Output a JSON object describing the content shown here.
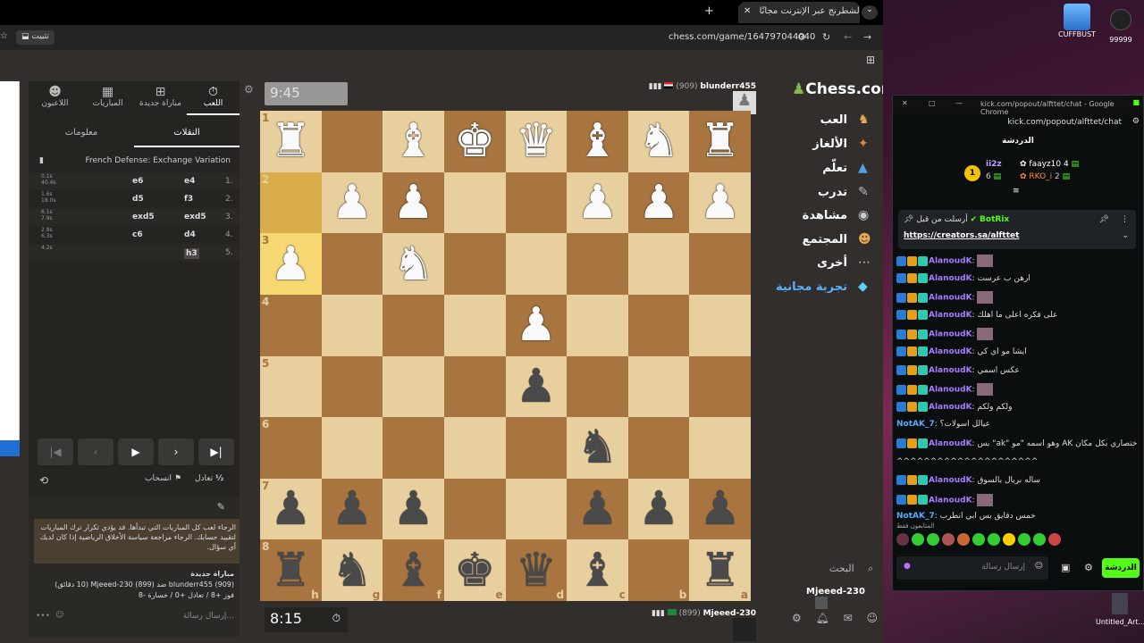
{
  "browser": {
    "tab_title": "إلعب الشطرنج عبر الإنترنت مجانًا",
    "url": "chess.com/game/164797044040",
    "install_label": "تثبيت"
  },
  "chess_nav": {
    "logo": "Chess.com",
    "items": [
      "العب",
      "الألغاز",
      "تعلّم",
      "تدرب",
      "مشاهدة",
      "المجتمع",
      "أخرى",
      "تجربة مجانية"
    ],
    "search_label": "البحث",
    "username": "Mjeeed-230"
  },
  "game": {
    "top_player": {
      "name": "blunderr455",
      "rating": "(909)",
      "clock": "9:45"
    },
    "bottom_player": {
      "name": "Mjeeed-230",
      "rating": "(899)",
      "clock": "8:15"
    },
    "files": [
      "h",
      "g",
      "f",
      "e",
      "d",
      "c",
      "b",
      "a"
    ],
    "ranks": [
      "1",
      "2",
      "3",
      "4",
      "5",
      "6",
      "7",
      "8"
    ]
  },
  "panel": {
    "tabs": [
      "اللعب",
      "مباراة جديدة",
      "المباريات",
      "اللاعبون"
    ],
    "subtabs": [
      "النقلات",
      "معلومات"
    ],
    "opening": "French Defense: Exchange Variation",
    "moves": [
      {
        "n": "1.",
        "w": "e4",
        "b": "e6",
        "t1": "0.1s",
        "t2": "40.4s"
      },
      {
        "n": "2.",
        "w": "f3",
        "b": "d5",
        "t1": "1.6s",
        "t2": "18.0s"
      },
      {
        "n": "3.",
        "w": "exd5",
        "b": "exd5",
        "t1": "6.1s",
        "t2": "7.9s"
      },
      {
        "n": "4.",
        "w": "d4",
        "b": "c6",
        "t1": "2.8s",
        "t2": "6.3s"
      },
      {
        "n": "5.",
        "w": "h3",
        "b": "",
        "t1": "4.2s",
        "t2": ""
      }
    ],
    "draw_label": "تعادل",
    "resign_label": "انسحاب",
    "warning": "الرجاء لعب كل المباريات التي تبدأها. قد يؤدي تكرار ترك المباريات لتقييد حسابك. الرجاء مراجعة سياسة الأخلاق الرياضية إذا كان لديك أي سؤال.",
    "new_game_title": "مباراة جديدة",
    "new_game_line1": "blunderr455 (909) ضد Mjeeed-230 (899) (10 دقائق)",
    "new_game_line2": "فوز +8 / تعادل +0 / خسارة -8",
    "message_placeholder": "إرسال رسالة..."
  },
  "kick": {
    "window_title": "kick.com/popout/alfttet/chat - Google Chrome",
    "url": "kick.com/popout/alfttet/chat",
    "header": "الدردشة",
    "top_gifters": [
      {
        "name": "ii2z",
        "count": "6"
      },
      {
        "name": "faayz10",
        "count": "4"
      },
      {
        "name": "RKO_i",
        "count": "2"
      }
    ],
    "pinned_by": "أرسلت من قبل",
    "pinned_user": "BotRix",
    "pinned_link": "https://creators.sa/alfttet",
    "messages": [
      {
        "user": "AlanoudK",
        "text": ""
      },
      {
        "user": "AlanoudK",
        "text": "ارهن ب عرست"
      },
      {
        "user": "AlanoudK",
        "text": ""
      },
      {
        "user": "AlanoudK",
        "text": "على فكره اعلى ما اهلك"
      },
      {
        "user": "AlanoudK",
        "text": ""
      },
      {
        "user": "AlanoudK",
        "text": "ايشا مو اي كي"
      },
      {
        "user": "AlanoudK",
        "text": "عكس اسمي"
      },
      {
        "user": "AlanoudK",
        "text": ""
      },
      {
        "user": "AlanoudK",
        "text": "ولكم ولكم"
      },
      {
        "user": "NotAK_7",
        "text": "عيالل اسولات؟"
      },
      {
        "user": "AlanoudK",
        "text": "بس \"ak\" وهو اسمه \"مو AK انه انا اختصاري بكل مكان"
      },
      {
        "user": "",
        "text": "^^^^^^^^^^^^^^^^^^^^^"
      },
      {
        "user": "AlanoudK",
        "text": "ساله بريال بالسوق"
      },
      {
        "user": "AlanoudK",
        "text": ""
      },
      {
        "user": "NotAK_7",
        "text": "خمس دقايق بس ابي انطرب"
      }
    ],
    "emote_row_label": "المتابعون فقط",
    "send_placeholder": "إرسال رسالة",
    "chat_button": "الدردشة"
  },
  "desktop": {
    "icon1": "CUFFBUST",
    "icon2": "99999",
    "icon3": "Untitled_Art..."
  }
}
